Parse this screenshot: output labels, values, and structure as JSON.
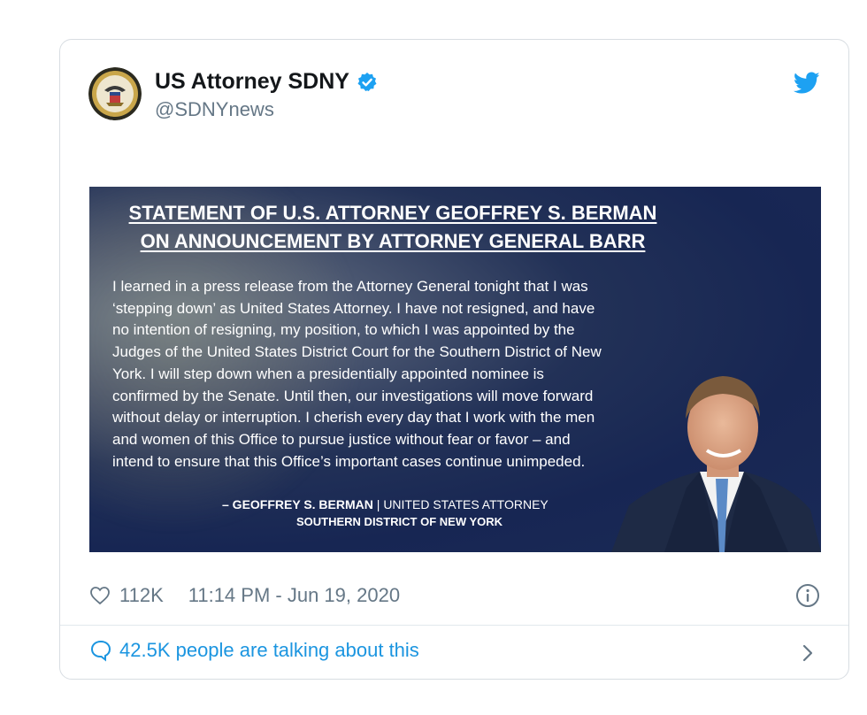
{
  "tweet": {
    "author_name": "US Attorney SDNY",
    "handle": "@SDNYnews",
    "likes": "112K",
    "timestamp": "11:14 PM - Jun 19, 2020",
    "conversation": "42.5K people are talking about this"
  },
  "statement": {
    "title_line1": "STATEMENT OF U.S. ATTORNEY GEOFFREY S. BERMAN",
    "title_line2": "ON ANNOUNCEMENT BY ATTORNEY GENERAL BARR",
    "body_lines": [
      "I learned in a press release from the Attorney General tonight that I was",
      "‘stepping down’ as United States Attorney.  I have not resigned, and have",
      "no intention of resigning, my position, to which I was appointed by the",
      "Judges of the United States District Court for the Southern District of New",
      "York.  I will step down when a presidentially appointed nominee is",
      "confirmed by the Senate.  Until then, our investigations will move forward",
      "without delay or interruption.  I cherish every day that I work with the men",
      "and women of this Office to pursue justice without fear or favor – and",
      "intend to ensure that this Office’s important cases continue unimpeded."
    ],
    "signature_name": "– GEOFFREY S. BERMAN",
    "signature_separator": "|",
    "signature_title": "UNITED STATES ATTORNEY",
    "signature_office": "SOUTHERN DISTRICT OF NEW YORK"
  },
  "colors": {
    "twitter_blue": "#1da1f2",
    "link_blue": "#1b95e0",
    "text_dark": "#14171a",
    "text_gray": "#657786",
    "banner_navy": "#1a2a57"
  },
  "icons": {
    "verified": "verified-badge-icon",
    "twitter": "twitter-bird-icon",
    "like": "heart-icon",
    "info": "info-icon",
    "reply": "speech-bubble-icon",
    "chevron": "chevron-right-icon"
  }
}
